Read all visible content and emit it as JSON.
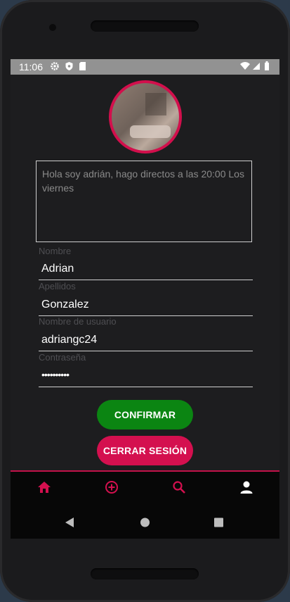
{
  "status_bar": {
    "time": "11:06",
    "left_icons": [
      "gear-icon",
      "shield-icon",
      "sd-card-icon"
    ],
    "right_icons": [
      "wifi-icon",
      "signal-icon",
      "battery-icon"
    ]
  },
  "profile": {
    "bio": "Hola soy adrián, hago directos a las 20:00 Los viernes",
    "fields": [
      {
        "label": "Nombre",
        "value": "Adrian"
      },
      {
        "label": "Apellidos",
        "value": "Gonzalez"
      },
      {
        "label": "Nombre de usuario",
        "value": "adriangc24"
      },
      {
        "label": "Contraseña",
        "value": "••••••••••"
      }
    ],
    "confirm_label": "CONFIRMAR",
    "logout_label": "CERRAR SESIÓN"
  },
  "bottom_nav": {
    "items": [
      "home-icon",
      "add-circle-icon",
      "search-icon",
      "person-icon"
    ],
    "active": "person-icon"
  },
  "system_nav": [
    "back-icon",
    "home-circle-icon",
    "recents-icon"
  ],
  "colors": {
    "accent": "#d4104f",
    "confirm": "#0b8512",
    "background": "#1d1d1f"
  }
}
